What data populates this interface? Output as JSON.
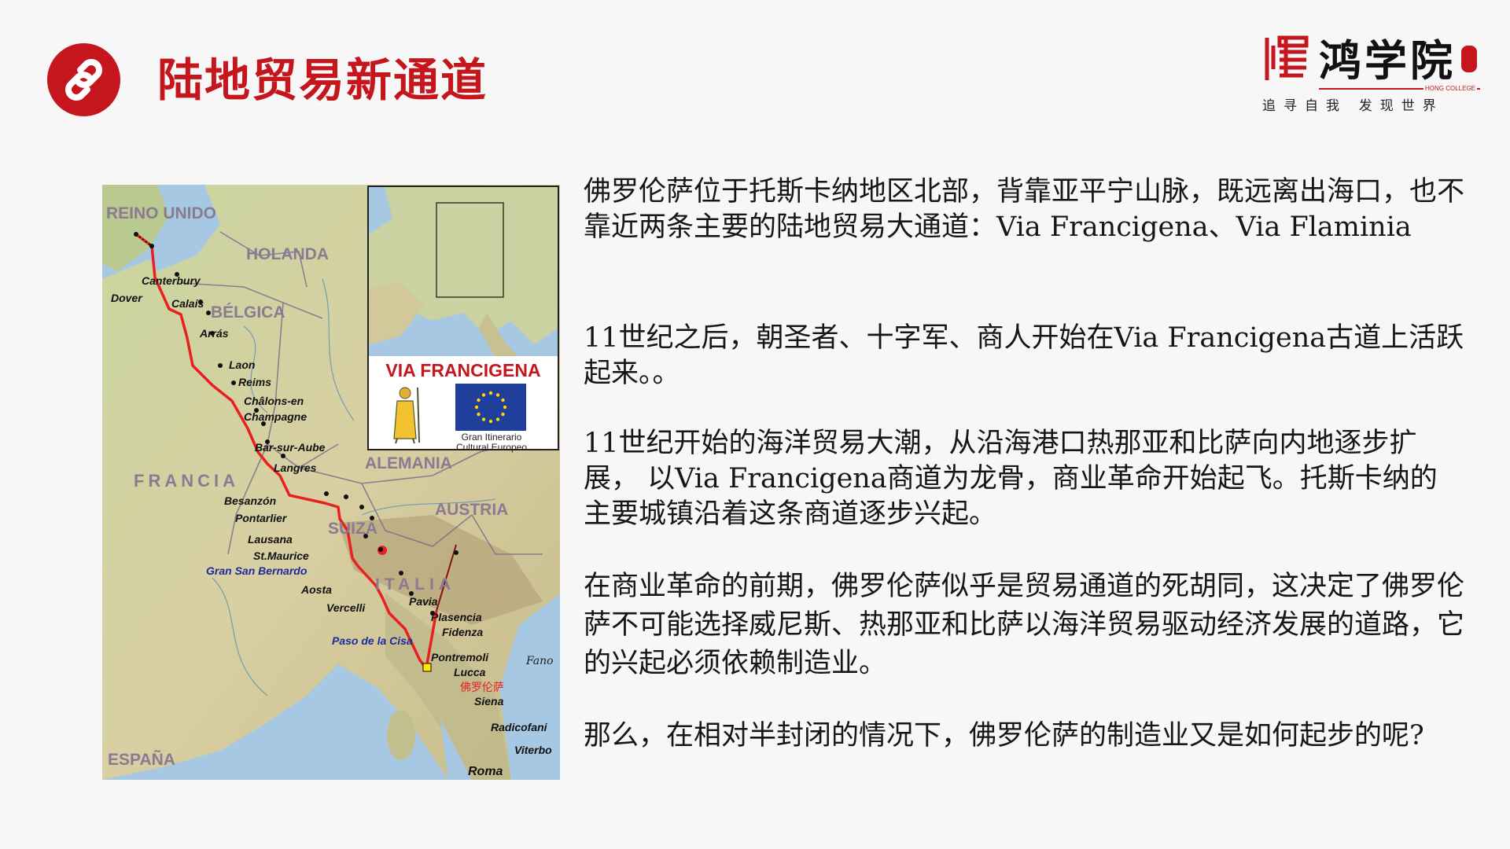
{
  "header": {
    "title": "陆地贸易新通道",
    "icon": "link-icon",
    "accent_color": "#c4161c"
  },
  "logo": {
    "name": "鸿学院",
    "english": "HONG COLLEGE",
    "slogan": "追寻自我 发现世界"
  },
  "map": {
    "countries": [
      "REINO UNIDO",
      "HOLANDA",
      "BÉLGICA",
      "FRANCIA",
      "ALEMANIA",
      "SUIZA",
      "AUSTRIA",
      "ITALIA",
      "ESPAÑA"
    ],
    "stops": [
      "Canterbury",
      "Dover",
      "Calais",
      "Arrás",
      "Laon",
      "Reims",
      "Châlons-en Champagne",
      "Bar-sur-Aube",
      "Langres",
      "Besanzón",
      "Pontarlier",
      "Lausana",
      "St.Maurice",
      "Aosta",
      "Vercelli",
      "Pavia",
      "Plasencia",
      "Fidenza",
      "Pontremoli",
      "Lucca",
      "佛罗伦萨",
      "Siena",
      "Radicofani",
      "Viterbo",
      "Roma",
      "Fano"
    ],
    "passes": [
      "Gran San Bernardo",
      "Paso de la Cisa"
    ],
    "inset_title": "VIA FRANCIGENA",
    "inset_caption_1": "Gran Itinerario",
    "inset_caption_2": "Cultural Europeo",
    "route_color": "#e8201e"
  },
  "content": {
    "p1": "佛罗伦萨位于托斯卡纳地区北部，背靠亚平宁山脉，既远离出海口，也不靠近两条主要的陆地贸易大通道：Via Francigena、Via Flaminia",
    "p2": "11世纪之后，朝圣者、十字军、商人开始在Via Francigena古道上活跃起来。。",
    "p3": "11世纪开始的海洋贸易大潮，从沿海港口热那亚和比萨向内地逐步扩展， 以Via Francigena商道为龙骨，商业革命开始起飞。托斯卡纳的主要城镇沿着这条商道逐步兴起。",
    "p4": "在商业革命的前期，佛罗伦萨似乎是贸易通道的死胡同，这决定了佛罗伦萨不可能选择威尼斯、热那亚和比萨以海洋贸易驱动经济发展的道路，它的兴起必须依赖制造业。",
    "p5": "那么，在相对半封闭的情况下，佛罗伦萨的制造业又是如何起步的呢?"
  }
}
